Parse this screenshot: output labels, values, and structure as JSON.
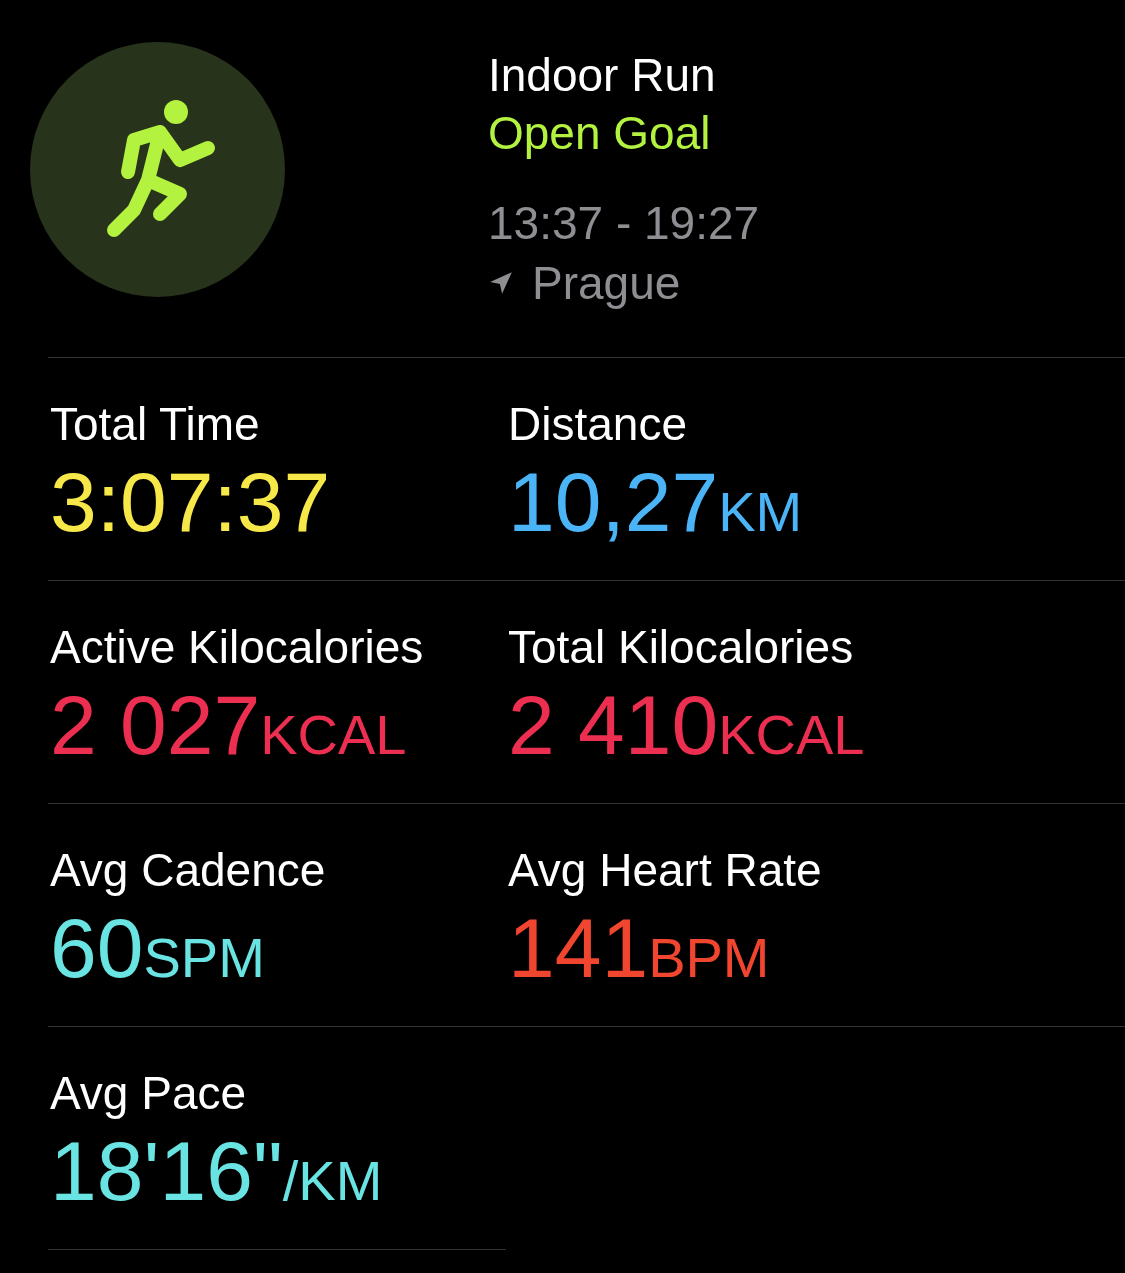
{
  "workout": {
    "title": "Indoor Run",
    "goal": "Open Goal",
    "time_range": "13:37 - 19:27",
    "location": "Prague"
  },
  "metrics": [
    {
      "label": "Total Time",
      "value": "3:07:37",
      "color": "#f7e84a"
    },
    {
      "label": "Distance",
      "value": "10,27",
      "unit": "KM",
      "color": "#4bb4f7"
    },
    {
      "label": "Active Kilocalories",
      "value": "2 027",
      "unit": "KCAL",
      "color": "#ec2f50"
    },
    {
      "label": "Total Kilocalories",
      "value": "2 410",
      "unit": "KCAL",
      "color": "#ec2f50"
    },
    {
      "label": "Avg Cadence",
      "value": "60",
      "unit": "SPM",
      "color": "#6ae4e2"
    },
    {
      "label": "Avg Heart Rate",
      "value": "141",
      "unit": "BPM",
      "color": "#f0452f"
    },
    {
      "label": "Avg Pace",
      "value": "18'16\"",
      "unit": "/KM",
      "color": "#6ae4e2"
    }
  ]
}
